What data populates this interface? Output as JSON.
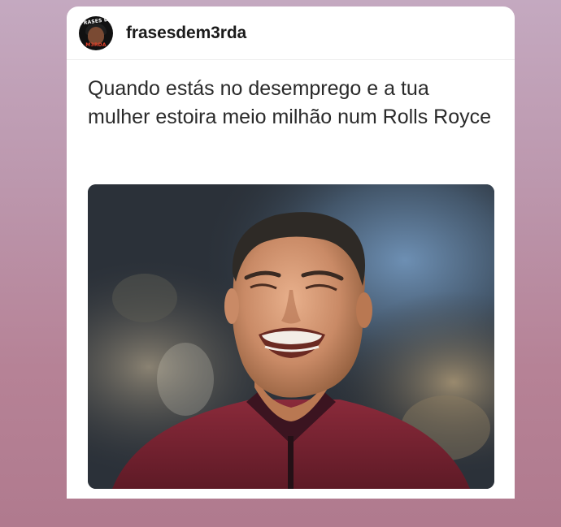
{
  "post": {
    "username": "frasesdem3rda",
    "avatar": {
      "top_text": "FRASES DE",
      "bottom_text": "M3RDA"
    },
    "caption": "Quando estás no desemprego e a tua mulher estoira meio milhão num Rolls Royce",
    "image": {
      "icon": "crying-man-photo"
    }
  },
  "colors": {
    "background_top": "#c4a9c0",
    "background_bottom": "#b07a8e",
    "card": "#ffffff",
    "text": "#1b1b1b"
  }
}
